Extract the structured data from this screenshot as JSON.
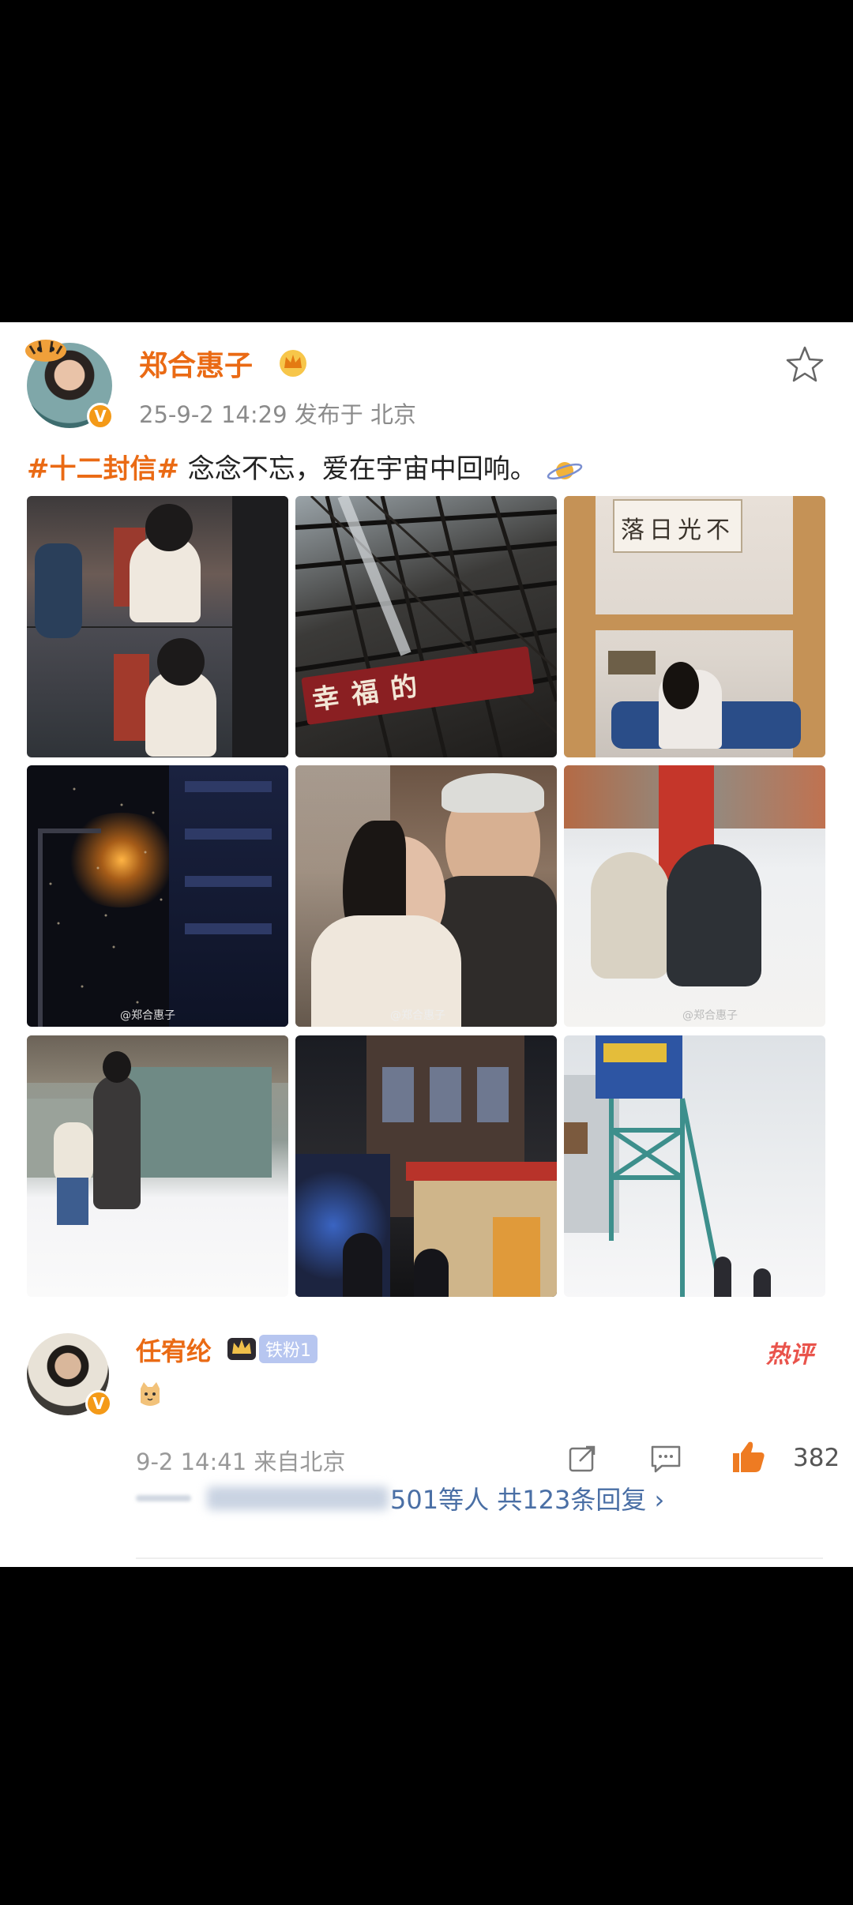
{
  "post": {
    "author": "郑合惠子",
    "meta": "25-9-2 14:29  发布于 北京",
    "hashtag": "#十二封信#",
    "text": " 念念不忘，爱在宇宙中回响。",
    "photos": [
      {
        "id": "photo-1"
      },
      {
        "id": "photo-2",
        "sign": "幸  福  的"
      },
      {
        "id": "photo-3",
        "calligraphy": "落日光不"
      },
      {
        "id": "photo-4",
        "watermark": "@郑合惠子"
      },
      {
        "id": "photo-5",
        "watermark": "@郑合惠子"
      },
      {
        "id": "photo-6",
        "watermark": "@郑合惠子"
      },
      {
        "id": "photo-7"
      },
      {
        "id": "photo-8"
      },
      {
        "id": "photo-9"
      }
    ]
  },
  "comment": {
    "author": "任宥纶",
    "badge": "铁粉1",
    "hot": "热评",
    "meta": "9-2 14:41  来自北京",
    "likes": "382",
    "replies": "501等人  共123条回复  ›"
  },
  "colors": {
    "accent": "#ea6a14",
    "link": "#4a6fa5",
    "background": "#000000",
    "card": "#ffffff"
  },
  "icons": [
    "star-icon",
    "verified-icon",
    "crown-icon",
    "share-icon",
    "comment-icon",
    "like-icon",
    "planet-icon",
    "cat-emoji-icon"
  ]
}
